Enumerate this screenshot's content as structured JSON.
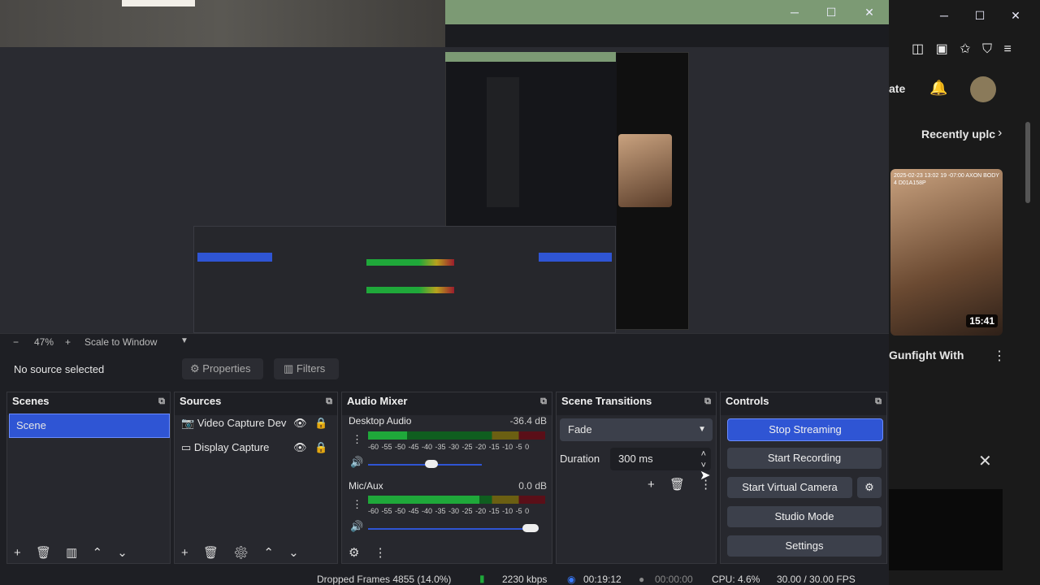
{
  "window": {
    "minimize": "─",
    "maximize": "☐",
    "close": "✕"
  },
  "zoom": {
    "minus": "−",
    "percent": "47%",
    "plus": "+",
    "mode": "Scale to Window"
  },
  "source_toolbar": {
    "status": "No source selected",
    "properties": "Properties",
    "filters": "Filters"
  },
  "scenes": {
    "title": "Scenes",
    "items": [
      "Scene"
    ]
  },
  "sources": {
    "title": "Sources",
    "items": [
      {
        "label": "Video Capture Dev",
        "icon": "camera-icon"
      },
      {
        "label": "Display Capture",
        "icon": "monitor-icon"
      }
    ]
  },
  "audio_mixer": {
    "title": "Audio Mixer",
    "channels": [
      {
        "name": "Desktop Audio",
        "db": "-36.4 dB",
        "level": 0.22,
        "volume": 0.56
      },
      {
        "name": "Mic/Aux",
        "db": "0.0 dB",
        "level": 0.63,
        "volume": 1.0
      }
    ],
    "scale": "-60 -55 -50 -45 -40 -35 -30 -25 -20 -15 -10 -5 0"
  },
  "transitions": {
    "title": "Scene Transitions",
    "selected": "Fade",
    "duration_label": "Duration",
    "duration_value": "300 ms"
  },
  "controls": {
    "title": "Controls",
    "stop_streaming": "Stop Streaming",
    "start_recording": "Start Recording",
    "start_virtual_camera": "Start Virtual Camera",
    "studio_mode": "Studio Mode",
    "settings": "Settings"
  },
  "status": {
    "dropped_frames": "Dropped Frames 4855 (14.0%)",
    "bitrate": "2230 kbps",
    "stream_time": "00:19:12",
    "record_time": "00:00:00",
    "cpu": "CPU: 4.6%",
    "fps": "30.00 / 30.00 FPS"
  },
  "browser": {
    "partial_title": "ate",
    "recently": "Recently uplc",
    "video_time": "15:41",
    "video_title": "Gunfight With",
    "thumb_overlay": "2025-02-23 13:02 19 -07:00 AXON BODY 4 D01A158P"
  },
  "colors": {
    "accent": "#2f55d4",
    "meter_green": "#1fa83a",
    "meter_yellow": "#b8a21e",
    "meter_red": "#9b1c2c"
  }
}
